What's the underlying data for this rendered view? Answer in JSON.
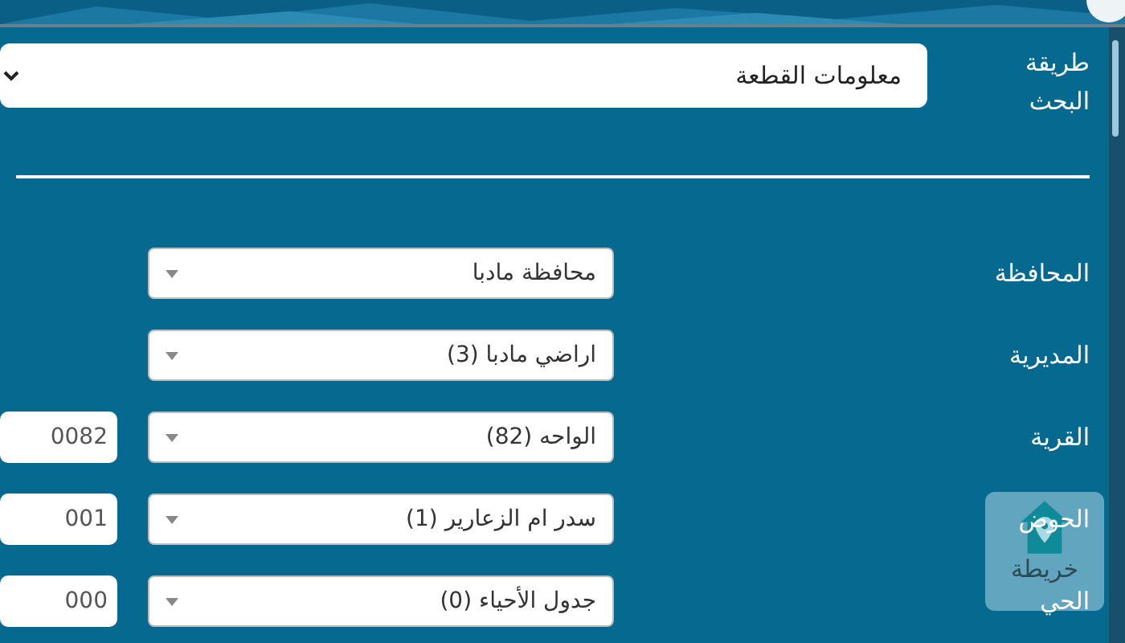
{
  "search_method": {
    "label": "طريقة البحث",
    "value": "معلومات القطعة"
  },
  "fields": [
    {
      "label": "المحافظة",
      "value": "محافظة مادبا"
    },
    {
      "label": "المديرية",
      "value": "اراضي مادبا (3)"
    },
    {
      "label": "القرية",
      "value": "الواحه (82)",
      "number": "0082"
    },
    {
      "label": "الحوض",
      "value": "سدر ام الزعارير (1)",
      "number": "001"
    },
    {
      "label": "الحي",
      "value": "جدول الأحياء (0)",
      "number": "000"
    }
  ],
  "map_button": {
    "label": "خريطة"
  }
}
